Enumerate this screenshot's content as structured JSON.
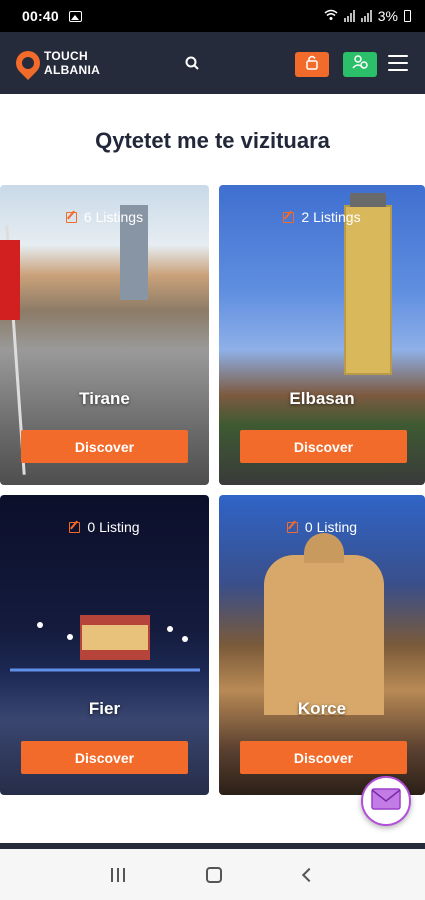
{
  "status_bar": {
    "time": "00:40",
    "battery": "3%"
  },
  "header": {
    "logo_line1": "TOUCH",
    "logo_line2": "ALBANIA",
    "icons": [
      "search-icon",
      "user-icon",
      "register-icon",
      "menu-icon"
    ]
  },
  "section": {
    "title": "Qytetet me te vizituara"
  },
  "cities": [
    {
      "name": "Tirane",
      "listings": "6 Listings",
      "button": "Discover"
    },
    {
      "name": "Elbasan",
      "listings": "2 Listings",
      "button": "Discover"
    },
    {
      "name": "Fier",
      "listings": "0 Listing",
      "button": "Discover"
    },
    {
      "name": "Korce",
      "listings": "0 Listing",
      "button": "Discover"
    }
  ],
  "colors": {
    "accent": "#f26b2a",
    "header_bg": "#252b3b",
    "green": "#2bbf6a",
    "title": "#22283a"
  }
}
